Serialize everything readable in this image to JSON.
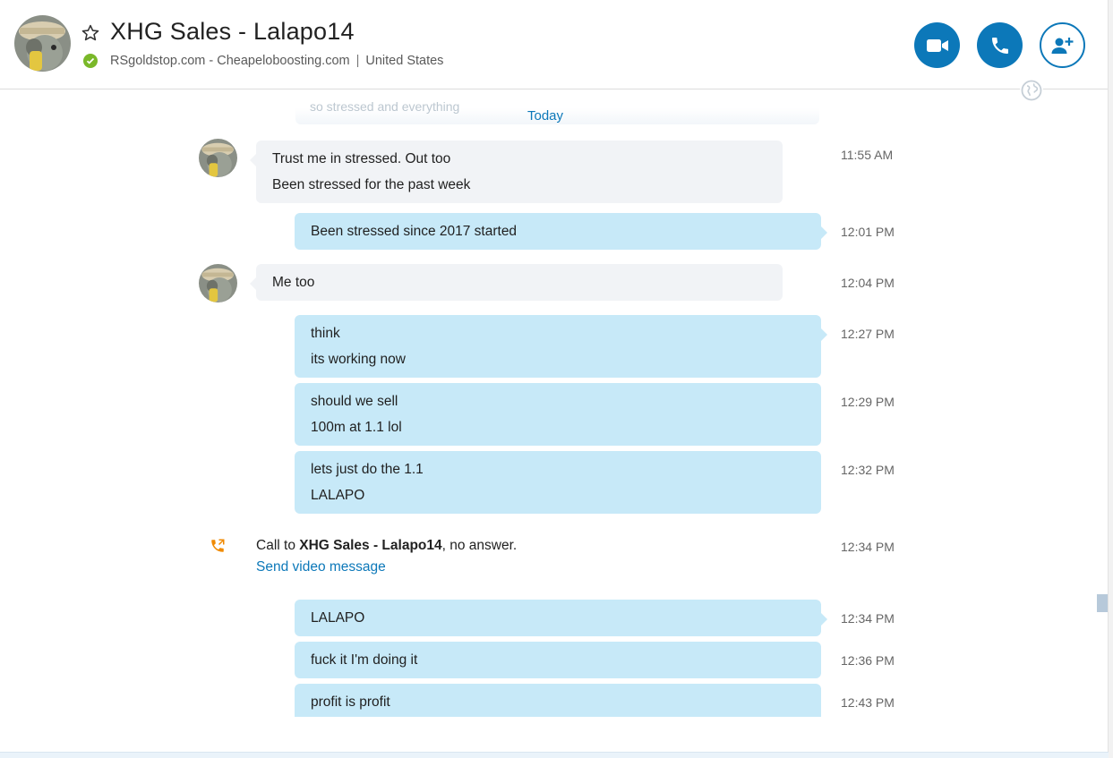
{
  "header": {
    "title": "XHG Sales - Lalapo14",
    "subtitle_sites": "RSgoldstop.com - Cheapeloboosting.com",
    "subtitle_separator": "|",
    "subtitle_location": "United States",
    "status": "online",
    "buttons": [
      {
        "name": "video-call",
        "icon": "video-camera-icon"
      },
      {
        "name": "audio-call",
        "icon": "phone-icon"
      },
      {
        "name": "add-people",
        "icon": "add-person-icon"
      }
    ]
  },
  "conversation": {
    "faded_previous": "so stressed and everything",
    "date_divider": "Today",
    "messages": [
      {
        "from": "them",
        "lines": [
          "Trust me in stressed. Out too",
          "Been stressed for the past week"
        ],
        "time": "11:55 AM"
      },
      {
        "from": "me",
        "lines": [
          "Been stressed since 2017 started"
        ],
        "time": "12:01 PM"
      },
      {
        "from": "them",
        "lines": [
          "Me too"
        ],
        "time": "12:04 PM"
      },
      {
        "from": "me",
        "lines": [
          "think",
          "its working now"
        ],
        "time": "12:27 PM"
      },
      {
        "from": "me",
        "lines": [
          "should we sell",
          "100m at 1.1 lol"
        ],
        "time": "12:29 PM"
      },
      {
        "from": "me",
        "lines": [
          "lets just do the 1.1",
          "LALAPO"
        ],
        "time": "12:32 PM"
      },
      {
        "from": "me",
        "lines": [
          "LALAPO"
        ],
        "time": "12:34 PM"
      },
      {
        "from": "me",
        "lines": [
          "fuck it I'm doing it"
        ],
        "time": "12:36 PM"
      },
      {
        "from": "me",
        "lines": [
          "profit is profit"
        ],
        "time": "12:43 PM"
      }
    ],
    "call_event": {
      "prefix": "Call to ",
      "name": "XHG Sales - Lalapo14",
      "suffix": ", no answer.",
      "link": "Send video message",
      "time": "12:34 PM"
    }
  },
  "colors": {
    "accent": "#0c78b9",
    "outgoing_bubble": "#c7e9f8",
    "incoming_bubble": "#f1f3f6",
    "online": "#7ab829",
    "missed_call": "#f08a00"
  }
}
